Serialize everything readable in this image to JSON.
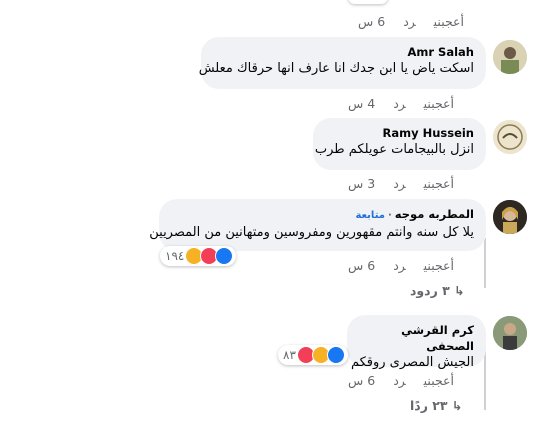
{
  "top_actions": {
    "like": "أعجبني",
    "reply": "رد",
    "time": "6 س"
  },
  "comments": [
    {
      "author": "Amr Salah",
      "text": "اسكت ياض يا ابن جدك انا عارف انها حرقاك معلش",
      "like": "أعجبني",
      "reply": "رد",
      "time": "4 س"
    },
    {
      "author": "Ramy Hussein",
      "text": "انزل بالبيجامات عويلكم طرب",
      "like": "أعجبني",
      "reply": "رد",
      "time": "3 س"
    },
    {
      "author": "المطربه موجه",
      "follow": "متابعة",
      "text": "يلا كل سنه وانتم مقهورين ومفروسين ومتهانين من المصريين",
      "reactions": "١٩٤",
      "like": "أعجبني",
      "reply": "رد",
      "time": "6 س",
      "replies": "٣ ردود"
    },
    {
      "author": "كرم القرشي الصحفى",
      "text": "الجيش المصرى روقكم",
      "reactions": "٨٣",
      "like": "أعجبني",
      "reply": "رد",
      "time": "6 س",
      "replies": "٢٣ ردًا"
    }
  ]
}
